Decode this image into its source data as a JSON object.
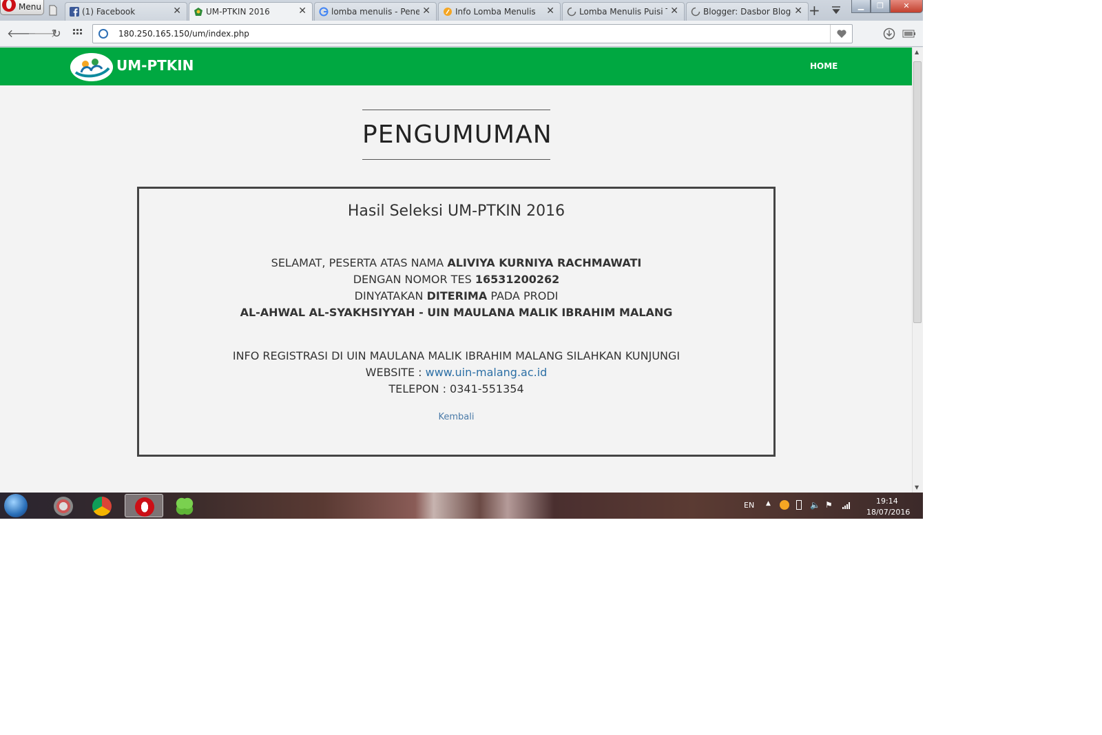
{
  "browser": {
    "menu_label": "Menu",
    "tabs": [
      {
        "title": "(1) Facebook",
        "icon": "facebook-icon"
      },
      {
        "title": "UM-PTKIN 2016",
        "icon": "umptkin-icon",
        "active": true
      },
      {
        "title": "lomba menulis - Penelu",
        "icon": "google-icon"
      },
      {
        "title": "Info Lomba Menulis",
        "icon": "site-icon"
      },
      {
        "title": "Lomba Menulis Puisi Te",
        "icon": "loading-icon"
      },
      {
        "title": "Blogger: Dasbor Blogger",
        "icon": "loading-icon"
      }
    ],
    "new_tab": "+",
    "address": "180.250.165.150/um/index.php",
    "accent_color": "#00a841"
  },
  "site": {
    "name": "UM-PTKIN",
    "nav_home": "HOME"
  },
  "page": {
    "title": "PENGUMUMAN",
    "box_title": "Hasil Seleksi UM-PTKIN 2016",
    "line1_prefix": "SELAMAT, PESERTA ATAS NAMA ",
    "participant_name": "ALIVIYA KURNIYA RACHMAWATI",
    "line2_prefix": "DENGAN NOMOR TES ",
    "test_number": "16531200262",
    "line3_prefix": "DINYATAKAN ",
    "status": "DITERIMA",
    "line3_suffix": " PADA PRODI",
    "program": "AL-AHWAL AL-SYAKHSIYYAH - UIN MAULANA MALIK IBRAHIM MALANG",
    "info_line": "INFO REGISTRASI DI UIN MAULANA MALIK IBRAHIM MALANG SILAHKAN KUNJUNGI",
    "website_label": "WEBSITE : ",
    "website_url": "www.uin-malang.ac.id",
    "phone_line": "TELEPON : 0341-551354",
    "back_link": "Kembali"
  },
  "taskbar": {
    "language": "EN",
    "time": "19:14",
    "date": "18/07/2016"
  }
}
